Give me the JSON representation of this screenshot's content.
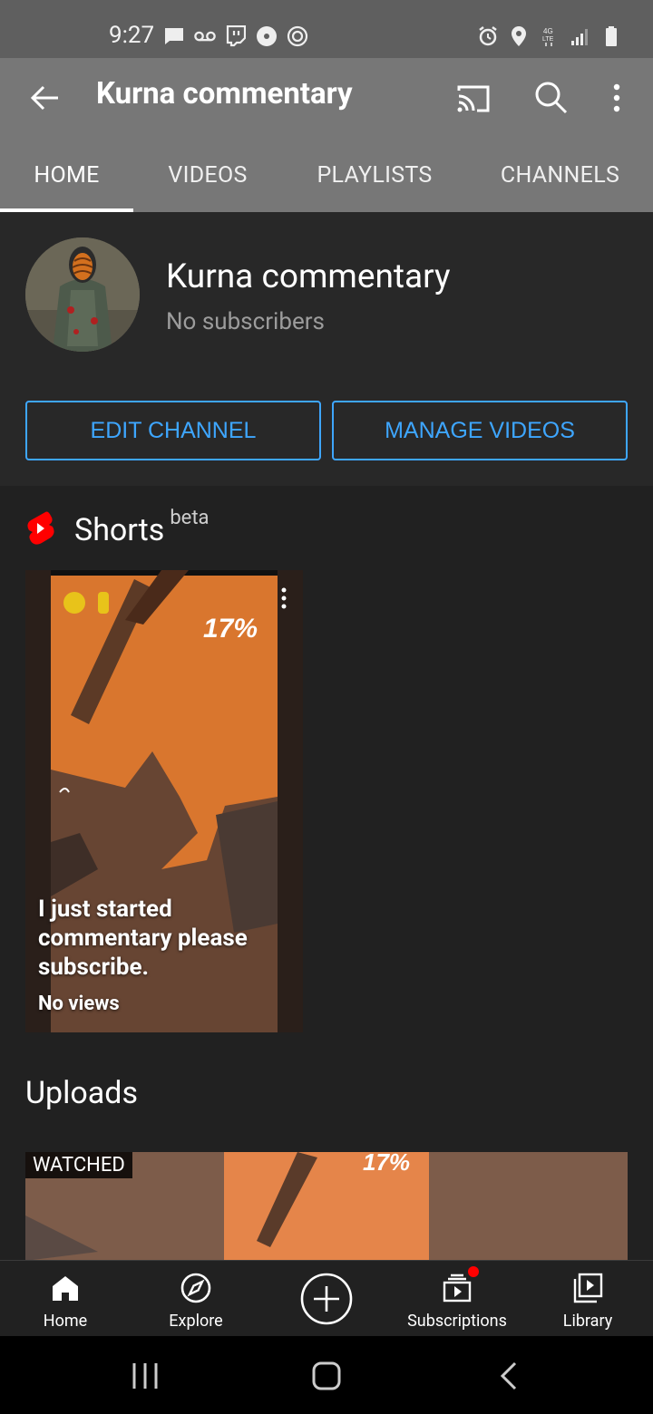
{
  "status_bar": {
    "time": "9:27",
    "left_icons": [
      "message-icon",
      "voicemail-icon",
      "twitch-icon",
      "dot-circle-icon",
      "at-icon"
    ],
    "right_icons": [
      "alarm-icon",
      "location-icon",
      "4g-lte-icon",
      "signal-icon",
      "battery-icon"
    ]
  },
  "app_bar": {
    "title": "Kurna commentary"
  },
  "tabs": [
    {
      "label": "HOME",
      "active": true
    },
    {
      "label": "VIDEOS",
      "active": false
    },
    {
      "label": "PLAYLISTS",
      "active": false
    },
    {
      "label": "CHANNELS",
      "active": false
    }
  ],
  "channel": {
    "name": "Kurna commentary",
    "subscribers": "No subscribers",
    "edit_button": "EDIT CHANNEL",
    "manage_button": "MANAGE VIDEOS"
  },
  "shorts": {
    "title": "Shorts",
    "badge": "beta",
    "item": {
      "title": "I just started commentary please subscribe.",
      "views": "No views",
      "thumbnail_percent_text": "17%"
    }
  },
  "uploads": {
    "title": "Uploads",
    "item": {
      "badge": "WATCHED",
      "thumbnail_percent_text": "17%"
    }
  },
  "bottom_nav": [
    {
      "label": "Home",
      "icon": "home-icon"
    },
    {
      "label": "Explore",
      "icon": "compass-icon"
    },
    {
      "label": "",
      "icon": "create-plus-icon"
    },
    {
      "label": "Subscriptions",
      "icon": "subscriptions-icon"
    },
    {
      "label": "Library",
      "icon": "library-icon"
    }
  ],
  "colors": {
    "accent_blue": "#3ea6ff",
    "youtube_red": "#ff0000",
    "background": "#212121",
    "app_bar": "#777777"
  }
}
